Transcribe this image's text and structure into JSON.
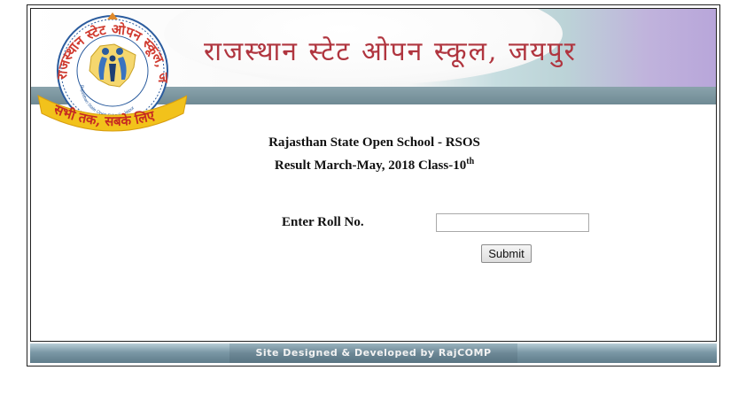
{
  "header": {
    "title_hindi": "राजस्थान स्टेट ओपन स्कूल, जयपुर",
    "logo": {
      "ring_text_hindi": "राजस्थान स्टेट ओपन स्कूल, जयपुर",
      "ring_text_english": "Rajasthan State Open School , Jaipur",
      "ribbon_text_hindi": "सभी तक, सबके लिए"
    }
  },
  "main": {
    "heading_line1": "Rajasthan State Open School - RSOS",
    "heading_line2": "Result March-May, 2018 Class-10",
    "heading_sup": "th",
    "roll_label": "Enter Roll No.",
    "roll_value": "",
    "submit_label": "Submit"
  },
  "footer": {
    "credit": "Site Designed & Developed by RajCOMP"
  },
  "colors": {
    "title": "#b0353f",
    "strip": "#6f8a94",
    "logo_ring": "#d03b30",
    "logo_ribbon": "#f2c21b"
  }
}
